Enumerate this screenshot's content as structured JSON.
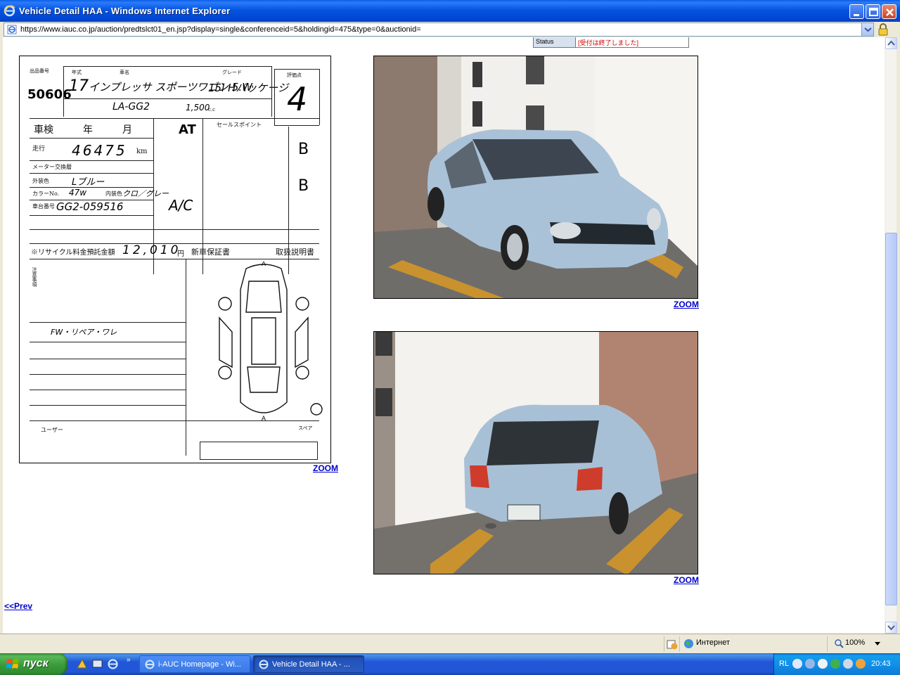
{
  "window": {
    "title": "Vehicle Detail HAA - Windows Internet Explorer",
    "url": "https://www.iauc.co.jp/auction/predtslct01_en.jsp?display=single&conferenceid=5&holdingid=475&type=0&auctionid="
  },
  "status_row": {
    "label": "Status",
    "value": "[受付は終了しました]"
  },
  "sheet": {
    "lot_number": "50606",
    "lot_label": "出品番号",
    "year_label": "年式",
    "year": "17",
    "name_label": "車名",
    "model_name": "インプレッサ スポーツワゴン 5.W",
    "grade_label": "グレード",
    "grade": "15i Hパッケージ",
    "score_label": "評価点",
    "score": "4",
    "model_code": "LA-GG2",
    "displacement": "1,500",
    "cc_unit": "c.c",
    "inspection_label": "車検",
    "inspection_year": "年",
    "inspection_month": "月",
    "at_label": "AT",
    "sales_point_label": "セールスポイント",
    "mileage_label": "走行",
    "mileage": "46475",
    "km_unit": "km",
    "meter_label": "メーター交換暦",
    "exterior_color_label": "外装色",
    "exterior_color": "Lブルー",
    "color_no_label": "カラーNo.",
    "color_no": "47w",
    "interior_label": "内装色",
    "interior_color": "クロ／グレー",
    "chassis_label": "車台番号",
    "chassis_no": "GG2-059516",
    "ac_label": "A/C",
    "ext_grade": "B",
    "int_grade": "B",
    "recycle_label": "※リサイクル料金預託金額",
    "recycle_amount": "12,010",
    "yen_unit": "円",
    "warranty_label": "新車保証書",
    "manual_label": "取扱説明書",
    "notes_label": "注意事項",
    "repair_note": "FW・リペア・ワレ",
    "user_label": "ユーザー",
    "spare_label": "スペア"
  },
  "links": {
    "zoom": "ZOOM",
    "prev": "<<Prev"
  },
  "statusbar": {
    "zone": "Интернет",
    "zoom": "100%"
  },
  "taskbar": {
    "start": "пуск",
    "tasks": [
      "i-AUC Homepage - Wi...",
      "Vehicle Detail HAA - ..."
    ],
    "lang": "RL",
    "clock": "20:43"
  }
}
